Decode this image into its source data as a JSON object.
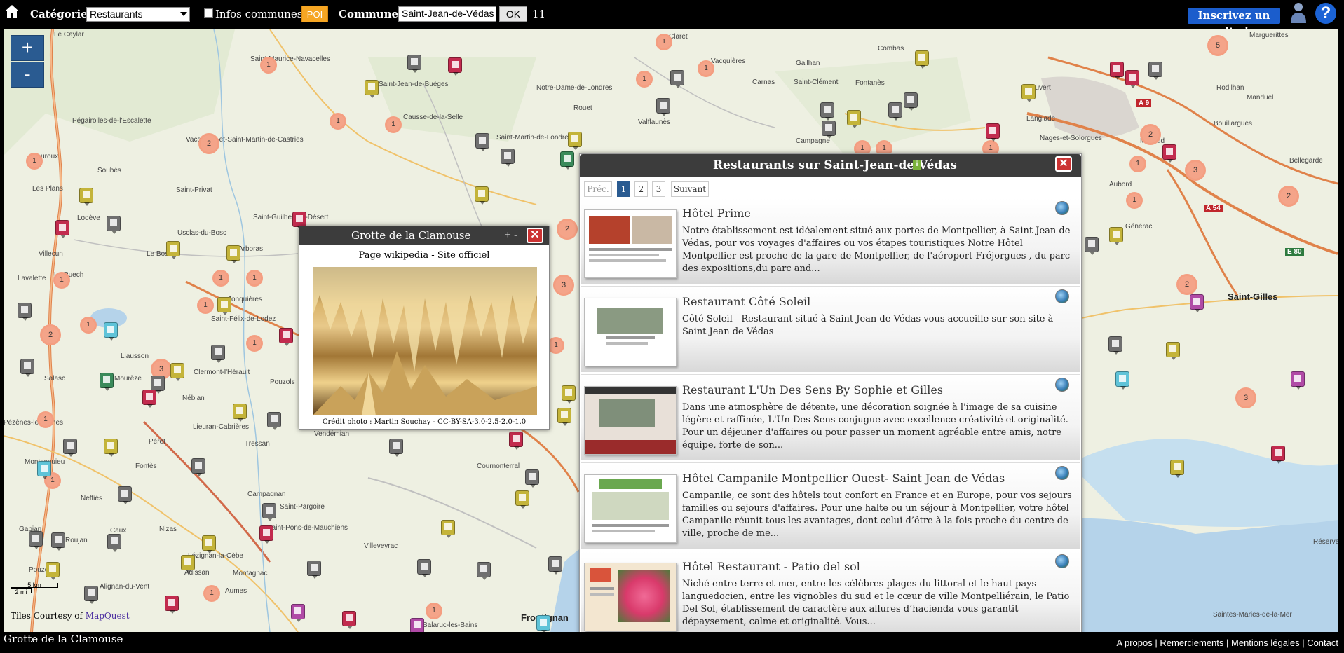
{
  "topbar": {
    "categorie_label": "Catégorie :",
    "categorie_value": "Restaurants",
    "infos_communes_label": "Infos communes",
    "poi_label": "POI",
    "commune_label": "Commune :",
    "commune_value": "Saint-Jean-de-Védas",
    "ok_label": "OK",
    "count": "11",
    "inscrivez_label": "Inscrivez un site !",
    "help_label": "?"
  },
  "map": {
    "zoom_in": "+",
    "zoom_out": "-",
    "scale_km": "5 km",
    "scale_mi": "2 mi",
    "tiles_prefix": "Tiles Courtesy of",
    "tiles_link": "MapQuest",
    "places": [
      {
        "name": "Le Caylar",
        "big": false
      },
      {
        "name": "Saint-Maurice-Navacelles",
        "big": false
      },
      {
        "name": "Saint-Jean-de-Buèges",
        "big": false
      },
      {
        "name": "Pégairolles-de-l'Escalette",
        "big": false
      },
      {
        "name": "Vacquerie-et-Saint-Martin-de-Castries",
        "big": false
      },
      {
        "name": "Causse-de-la-Selle",
        "big": false
      },
      {
        "name": "Notre-Dame-de-Londres",
        "big": false
      },
      {
        "name": "Saint-Martin-de-Londres",
        "big": false
      },
      {
        "name": "Rouet",
        "big": false
      },
      {
        "name": "Claret",
        "big": false
      },
      {
        "name": "Vacquières",
        "big": false
      },
      {
        "name": "Gailhan",
        "big": false
      },
      {
        "name": "Combas",
        "big": false
      },
      {
        "name": "Carnas",
        "big": false
      },
      {
        "name": "Saint-Clément",
        "big": false
      },
      {
        "name": "Fontanès",
        "big": false
      },
      {
        "name": "Vauvert",
        "big": false
      },
      {
        "name": "Marguerittes",
        "big": false
      },
      {
        "name": "Rodilhan",
        "big": false
      },
      {
        "name": "Manduel",
        "big": false
      },
      {
        "name": "Langlade",
        "big": false
      },
      {
        "name": "Nages-et-Solorgues",
        "big": false
      },
      {
        "name": "Bouillargues",
        "big": false
      },
      {
        "name": "Milhaud",
        "big": false
      },
      {
        "name": "Aubord",
        "big": false
      },
      {
        "name": "Bellegarde",
        "big": false
      },
      {
        "name": "Générac",
        "big": false
      },
      {
        "name": "Saint-Gilles",
        "big": true
      },
      {
        "name": "Valflaunès",
        "big": false
      },
      {
        "name": "Campagne",
        "big": false
      },
      {
        "name": "Soubès",
        "big": false
      },
      {
        "name": "Lauroux",
        "big": false
      },
      {
        "name": "Les Plans",
        "big": false
      },
      {
        "name": "Saint-Privat",
        "big": false
      },
      {
        "name": "Lodève",
        "big": false
      },
      {
        "name": "Usclas-du-Bosc",
        "big": false
      },
      {
        "name": "Le Bosc",
        "big": false
      },
      {
        "name": "Arboras",
        "big": false
      },
      {
        "name": "Saint-Guilhem-le-Désert",
        "big": false
      },
      {
        "name": "Villecun",
        "big": false
      },
      {
        "name": "Le Puech",
        "big": false
      },
      {
        "name": "Lavalette",
        "big": false
      },
      {
        "name": "Jonquières",
        "big": false
      },
      {
        "name": "Saint-Félix-de-Lodez",
        "big": false
      },
      {
        "name": "Liausson",
        "big": false
      },
      {
        "name": "Salasc",
        "big": false
      },
      {
        "name": "Mourèze",
        "big": false
      },
      {
        "name": "Nébian",
        "big": false
      },
      {
        "name": "Clermont-l'Hérault",
        "big": false
      },
      {
        "name": "Pouzols",
        "big": false
      },
      {
        "name": "Lieuran-Cabrières",
        "big": false
      },
      {
        "name": "Péret",
        "big": false
      },
      {
        "name": "Tressan",
        "big": false
      },
      {
        "name": "Vendémian",
        "big": false
      },
      {
        "name": "Fontès",
        "big": false
      },
      {
        "name": "Campagnan",
        "big": false
      },
      {
        "name": "Saint-Pargoire",
        "big": false
      },
      {
        "name": "Saint-Pons-de-Mauchiens",
        "big": false
      },
      {
        "name": "Cournonterral",
        "big": false
      },
      {
        "name": "Villeveyrac",
        "big": false
      },
      {
        "name": "Nizas",
        "big": false
      },
      {
        "name": "Caux",
        "big": false
      },
      {
        "name": "Neffiès",
        "big": false
      },
      {
        "name": "Montesquieu",
        "big": false
      },
      {
        "name": "Gabian",
        "big": false
      },
      {
        "name": "Roujan",
        "big": false
      },
      {
        "name": "Pouzolles",
        "big": false
      },
      {
        "name": "Alignan-du-Vent",
        "big": false
      },
      {
        "name": "Adissan",
        "big": false
      },
      {
        "name": "Lézignan-la-Cèbe",
        "big": false
      },
      {
        "name": "Montagnac",
        "big": false
      },
      {
        "name": "Aumes",
        "big": false
      },
      {
        "name": "Balaruc-les-Bains",
        "big": false
      },
      {
        "name": "Pézènes-les-Mines",
        "big": false
      },
      {
        "name": "Frontignan",
        "big": true
      },
      {
        "name": "Saintes-Maries-de-la-Mer",
        "big": false
      },
      {
        "name": "Réserve",
        "big": false
      }
    ],
    "road_labels": [
      "A 9",
      "A 54",
      "E 80"
    ],
    "clusters": [
      "1",
      "1",
      "1",
      "1",
      "2",
      "1",
      "1",
      "1",
      "1",
      "1",
      "1",
      "1",
      "2",
      "1",
      "1",
      "1",
      "1",
      "1",
      "1",
      "2",
      "1",
      "1",
      "1",
      "1",
      "2",
      "1",
      "3",
      "1",
      "5",
      "2",
      "3",
      "2",
      "3",
      "3"
    ]
  },
  "grotte_popup": {
    "title": "Grotte de la Clamouse",
    "plus": "+",
    "minus": "-",
    "close": "✕",
    "link_wikipedia": "Page wikipedia",
    "separator": " - ",
    "link_site": "Site officiel",
    "credit": "Crédit photo : Martin Souchay - CC-BY-SA-3.0-2.5-2.0-1.0"
  },
  "panel": {
    "title": "Restaurants sur Saint-Jean-de-Védas",
    "info_badge": "i",
    "close": "✕",
    "pagination": {
      "prev": "Préc.",
      "pages": [
        "1",
        "2",
        "3"
      ],
      "next": "Suivant",
      "current": "1"
    },
    "items": [
      {
        "name": "Hôtel Prime",
        "description": "Notre établissement est idéalement situé aux portes de Montpellier, à Saint Jean de Védas, pour vos voyages d'affaires ou vos étapes touristiques Notre Hôtel Montpellier est proche de la gare de Montpellier, de l'aéroport Fréjorgues , du parc des expositions,du parc and...",
        "thumb_color": "#c9b8a4"
      },
      {
        "name": "Restaurant Côté Soleil",
        "description": "Côté Soleil - Restaurant situé à Saint Jean de Védas vous accueille sur son site à Saint Jean de Védas",
        "thumb_color": "#8a9a82"
      },
      {
        "name": "Restaurant L'Un Des Sens By Sophie et Gilles",
        "description": "Dans une atmosphère de détente, une décoration soignée à l'image de sa cuisine légère et raffinée, L'Un Des Sens conjugue avec excellence créativité et originalité. Pour un déjeuner d'affaires ou pour passer un moment agréable entre amis, notre équipe, forte de son...",
        "thumb_color": "#9a2b2b"
      },
      {
        "name": "Hôtel Campanile Montpellier Ouest- Saint Jean de Védas",
        "description": "Campanile, ce sont des hôtels tout confort en France et en Europe, pour vos sejours familles ou sejours d'affaires. Pour une halte ou un séjour à Montpellier, votre hôtel Campanile réunit tous les avantages, dont celui d’être à la fois proche du centre de ville, proche de me...",
        "thumb_color": "#6aa84f"
      },
      {
        "name": "Hôtel Restaurant - Patio del sol",
        "description": "Niché entre terre et mer, entre les célèbres plages du littoral et le haut pays languedocien, entre les vignobles du sud et le cœur de ville Montpelliérain, le Patio Del Sol, établissement de caractère aux allures d’hacienda vous garantit dépaysement, calme et originalité. Vous...",
        "thumb_color": "#e04a78"
      }
    ]
  },
  "bottombar": {
    "current_place": "Grotte de la Clamouse",
    "links": [
      "A propos",
      "Remerciements",
      "Mentions légales",
      "Contact"
    ],
    "sep": " | "
  }
}
